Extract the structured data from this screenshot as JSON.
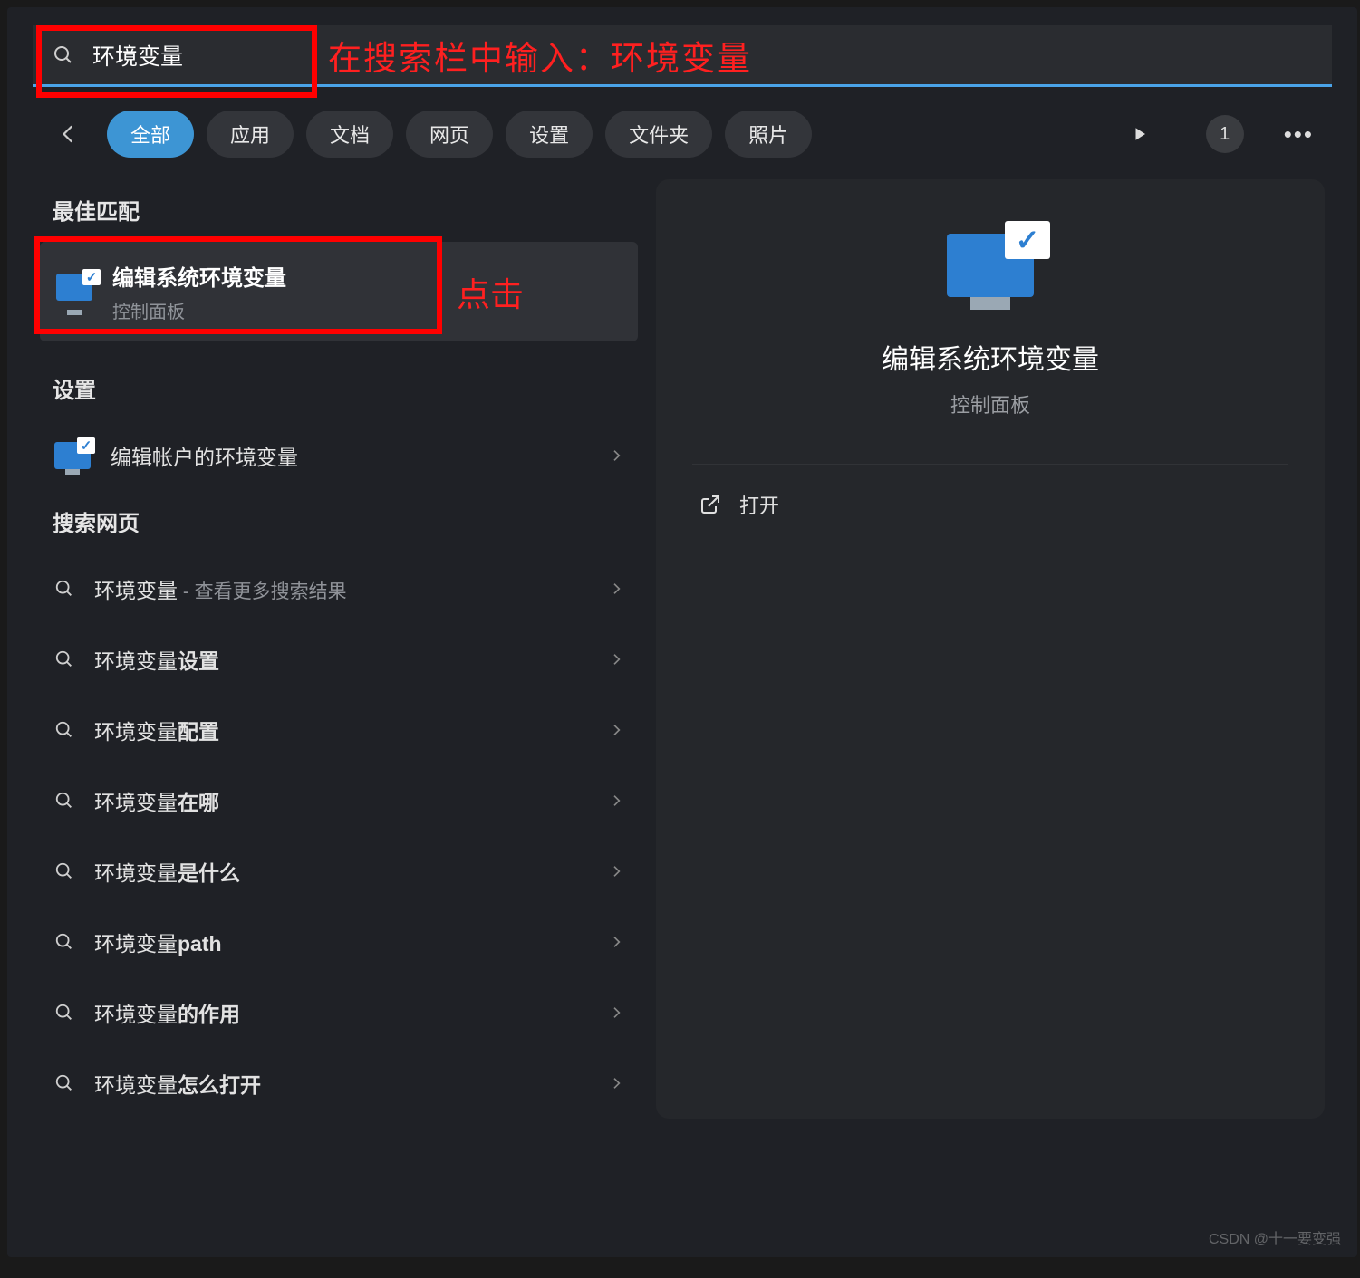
{
  "search": {
    "query": "环境变量",
    "annotation": "在搜索栏中输入：环境变量"
  },
  "tabs": [
    "全部",
    "应用",
    "文档",
    "网页",
    "设置",
    "文件夹",
    "照片"
  ],
  "top_right": {
    "badge": "1"
  },
  "sections": {
    "best_match": "最佳匹配",
    "settings": "设置",
    "search_web": "搜索网页"
  },
  "best_match_item": {
    "title": "编辑系统环境变量",
    "sub": "控制面板",
    "annotation": "点击"
  },
  "settings_items": [
    {
      "title": "编辑帐户的环境变量"
    }
  ],
  "web_items": [
    {
      "prefix": "环境变量",
      "suffix": " - 查看更多搜索结果",
      "bold": ""
    },
    {
      "prefix": "环境变量",
      "bold": "设置",
      "suffix": ""
    },
    {
      "prefix": "环境变量",
      "bold": "配置",
      "suffix": ""
    },
    {
      "prefix": "环境变量",
      "bold": "在哪",
      "suffix": ""
    },
    {
      "prefix": "环境变量",
      "bold": "是什么",
      "suffix": ""
    },
    {
      "prefix": "环境变量",
      "bold": "path",
      "suffix": ""
    },
    {
      "prefix": "环境变量",
      "bold": "的作用",
      "suffix": ""
    },
    {
      "prefix": "环境变量",
      "bold": "怎么打开",
      "suffix": ""
    }
  ],
  "right_panel": {
    "title": "编辑系统环境变量",
    "sub": "控制面板",
    "open": "打开"
  },
  "watermark": "CSDN @十一要变强"
}
